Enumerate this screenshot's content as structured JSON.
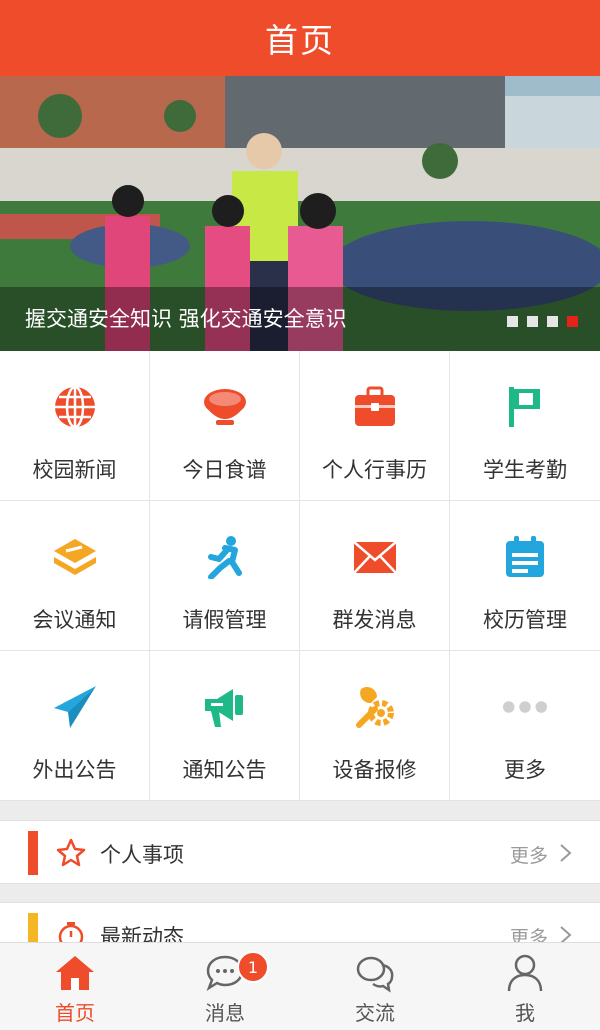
{
  "header": {
    "title": "首页"
  },
  "banner": {
    "caption": "握交通安全知识 强化交通安全意识",
    "slide_count": 4,
    "active_slide": 4
  },
  "grid": [
    {
      "label": "校园新闻",
      "icon": "globe-icon",
      "color": "#ee4c2b"
    },
    {
      "label": "今日食谱",
      "icon": "bowl-icon",
      "color": "#ee4c2b"
    },
    {
      "label": "个人行事历",
      "icon": "briefcase-icon",
      "color": "#ee4c2b"
    },
    {
      "label": "学生考勤",
      "icon": "flag-icon",
      "color": "#1fb889"
    },
    {
      "label": "会议通知",
      "icon": "layers-icon",
      "color": "#f5a623"
    },
    {
      "label": "请假管理",
      "icon": "running-person-icon",
      "color": "#22a6dd"
    },
    {
      "label": "群发消息",
      "icon": "envelope-icon",
      "color": "#ee4c2b"
    },
    {
      "label": "校历管理",
      "icon": "calendar-icon",
      "color": "#22a6dd"
    },
    {
      "label": "外出公告",
      "icon": "paper-plane-icon",
      "color": "#22a6dd"
    },
    {
      "label": "通知公告",
      "icon": "megaphone-icon",
      "color": "#1fb889"
    },
    {
      "label": "设备报修",
      "icon": "wrench-gear-icon",
      "color": "#f5a623"
    },
    {
      "label": "更多",
      "icon": "more-dots-icon",
      "color": "#cfcfcf"
    }
  ],
  "sections": [
    {
      "title": "个人事项",
      "more": "更多",
      "icon": "star-icon",
      "bar_color": "#ee4c2b"
    },
    {
      "title": "最新动态",
      "more": "更多",
      "icon": "timer-icon",
      "bar_color": "#f5b623"
    }
  ],
  "tabbar": {
    "tabs": [
      {
        "label": "首页",
        "icon": "home-icon",
        "active": true
      },
      {
        "label": "消息",
        "icon": "chat-bubble-icon",
        "active": false
      },
      {
        "label": "交流",
        "icon": "conversation-icon",
        "active": false
      },
      {
        "label": "我",
        "icon": "user-icon",
        "active": false
      }
    ],
    "message_badge": "1"
  },
  "colors": {
    "accent": "#ee4c2b"
  }
}
